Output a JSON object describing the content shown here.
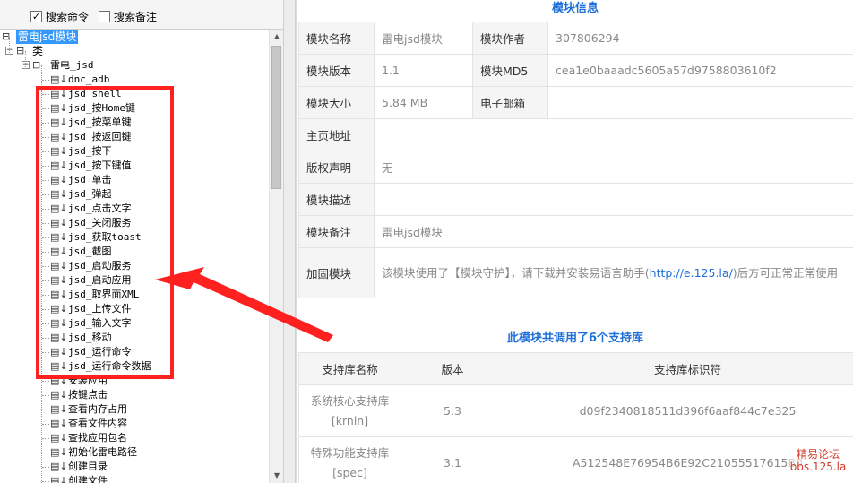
{
  "search_options": {
    "search_commands": {
      "label": "搜索命令",
      "checked": true
    },
    "search_notes": {
      "label": "搜索备注",
      "checked": false
    }
  },
  "tree": {
    "root": "雷电jsd模块",
    "class_node": "类",
    "module_node": "雷电_jsd",
    "commands": [
      "dnc_adb",
      "jsd_shell",
      "jsd_按Home键",
      "jsd_按菜单键",
      "jsd_按返回键",
      "jsd_按下",
      "jsd_按下键值",
      "jsd_单击",
      "jsd_弹起",
      "jsd_点击文字",
      "jsd_关闭服务",
      "jsd_获取toast",
      "jsd_截图",
      "jsd_启动服务",
      "jsd_启动应用",
      "jsd_取界面XML",
      "jsd_上传文件",
      "jsd_输入文字",
      "jsd_移动",
      "jsd_运行命令",
      "jsd_运行命令数据",
      "安装应用",
      "按键点击",
      "查看内存占用",
      "查看文件内容",
      "查找应用包名",
      "初始化雷电路径",
      "创建目录",
      "创建文件"
    ]
  },
  "module_info": {
    "section_title": "模块信息",
    "rows": [
      {
        "k1": "模块名称",
        "v1": "雷电jsd模块",
        "k2": "模块作者",
        "v2": "307806294"
      },
      {
        "k1": "模块版本",
        "v1": "1.1",
        "k2": "模块MD5",
        "v2": "cea1e0baaadc5605a57d9758803610f2"
      },
      {
        "k1": "模块大小",
        "v1": "5.84 MB",
        "k2": "电子邮箱",
        "v2": ""
      }
    ],
    "homepage": {
      "label": "主页地址",
      "value": ""
    },
    "copyright": {
      "label": "版权声明",
      "value": "无"
    },
    "description": {
      "label": "模块描述",
      "value": ""
    },
    "remark": {
      "label": "模块备注",
      "value": "雷电jsd模块"
    },
    "protection": {
      "label": "加固模块",
      "text_before": "该模块使用了【模块守护】，请下载并安装易语言助手(",
      "link": "http://e.125.la/",
      "text_after": ")后方可正常正常使用"
    }
  },
  "support_libs": {
    "section_title": "此模块共调用了6个支持库",
    "headers": {
      "name": "支持库名称",
      "version": "版本",
      "id": "支持库标识符"
    },
    "rows": [
      {
        "name": "系统核心支持库",
        "code": "[krnln]",
        "version": "5.3",
        "id": "d09f2340818511d396f6aaf844c7e325"
      },
      {
        "name": "特殊功能支持库",
        "code": "[spec]",
        "version": "3.1",
        "id": "A512548E76954B6E92C21055517615B0"
      }
    ]
  },
  "watermark": {
    "line1": "精易论坛",
    "line2": "bbs.125.la"
  },
  "colors": {
    "accent": "#1f6fd8",
    "annotation": "#ff2020",
    "selection": "#3399ff"
  }
}
